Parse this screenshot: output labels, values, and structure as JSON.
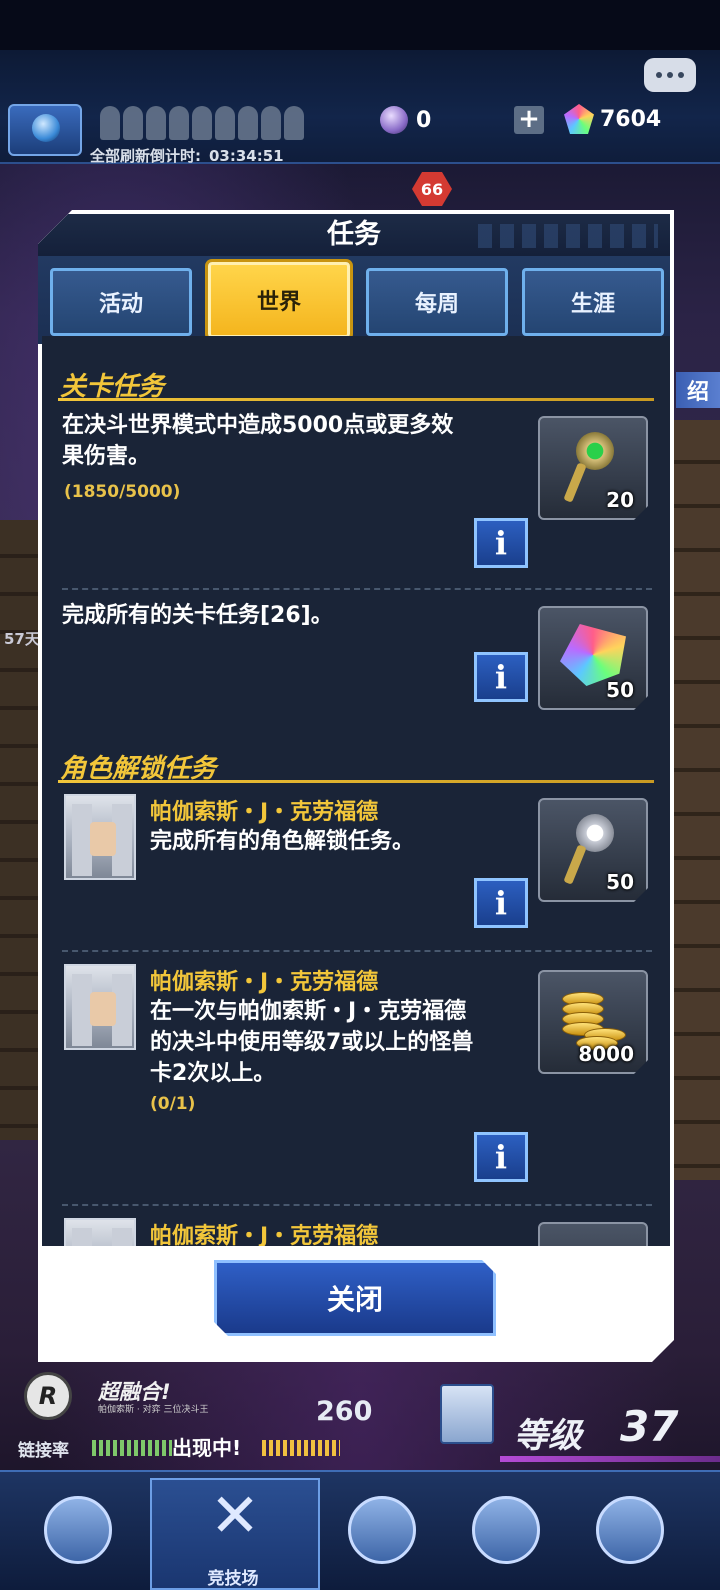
{
  "header": {
    "refresh_label": "全部刷新倒计时:",
    "refresh_time": "03:34:51",
    "orb_count": "0",
    "gem_count": "7604",
    "plus_label": "+",
    "notification_badge": "66"
  },
  "background": {
    "side_count": "57天",
    "side_tab": "绍"
  },
  "dialog": {
    "title": "任务",
    "tabs": [
      {
        "label": "活动",
        "active": false
      },
      {
        "label": "世界",
        "active": true
      },
      {
        "label": "每周",
        "active": false
      },
      {
        "label": "生涯",
        "active": false
      }
    ],
    "sections": {
      "stage": {
        "title": "关卡任务",
        "tasks": [
          {
            "text_line1": "在决斗世界模式中造成5000点或更多效",
            "text_line2": "果伤害。",
            "progress": "(1850/5000)",
            "reward_icon": "green-key-icon",
            "reward_count": "20",
            "info_label": "i"
          },
          {
            "text_line1": "完成所有的关卡任务[26]。",
            "reward_icon": "rainbow-gem-icon",
            "reward_count": "50",
            "info_label": "i"
          }
        ]
      },
      "character": {
        "title": "角色解锁任务",
        "tasks": [
          {
            "character": "帕伽索斯・J・克劳福德",
            "text_line1": "完成所有的角色解锁任务。",
            "reward_icon": "silver-key-icon",
            "reward_count": "50",
            "info_label": "i"
          },
          {
            "character": "帕伽索斯・J・克劳福德",
            "text_line1": "在一次与帕伽索斯・J・克劳福德",
            "text_line2": "的决斗中使用等级7或以上的怪兽",
            "text_line3": "卡2次以上。",
            "progress": "(0/1)",
            "reward_icon": "gold-coins-icon",
            "reward_count": "8000",
            "info_label": "i"
          },
          {
            "character": "帕伽索斯・J・克劳福德"
          }
        ]
      }
    },
    "close_label": "关闭"
  },
  "status": {
    "fusion_label": "超融合!",
    "fusion_sub": "帕伽索斯 · 对弈 三位决斗王",
    "count": "260",
    "link_rate_label": "链接率",
    "appearing_label": "出现中!",
    "level_label": "等级",
    "level_value": "37"
  },
  "nav": {
    "arena_label": "竞技场"
  },
  "colors": {
    "accent_gold": "#f2c63a",
    "panel_dark": "#1a2437",
    "tab_blue": "#365a8f",
    "info_blue": "#2c5fc0"
  }
}
